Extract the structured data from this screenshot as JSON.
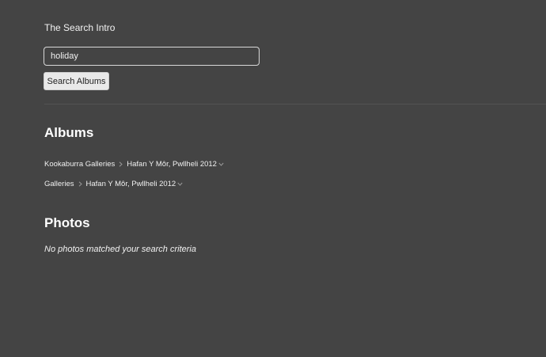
{
  "intro": {
    "text": "The Search Intro"
  },
  "search": {
    "value": "holiday",
    "button_label": "Search Albums"
  },
  "albums": {
    "title": "Albums",
    "results": [
      {
        "parent": "Kookaburra Galleries",
        "album": "Hafan Y Môr, Pwllheli 2012"
      },
      {
        "parent": "Galleries",
        "album": "Hafan Y Môr, Pwllheli 2012"
      }
    ]
  },
  "photos": {
    "title": "Photos",
    "empty_message": "No photos matched your search criteria"
  },
  "icons": {
    "separator": "chevron-right-icon",
    "dropdown": "chevron-down-icon"
  },
  "colors": {
    "background": "#444444",
    "text": "#ffffff",
    "button_bg": "#e9e9e9",
    "divider": "#525252"
  }
}
